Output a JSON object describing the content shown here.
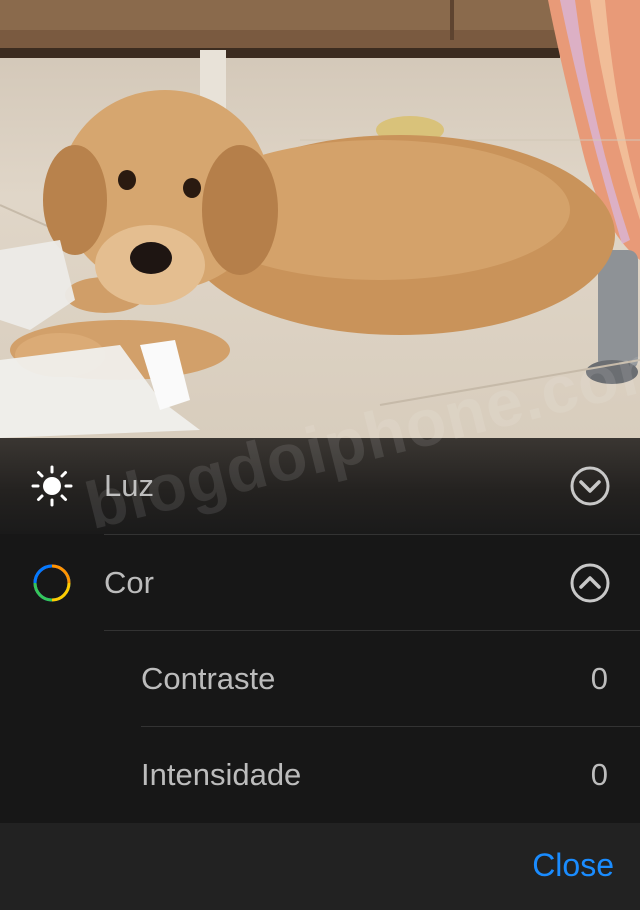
{
  "photo": {
    "subject": "golden retriever puppy lying on tiled floor"
  },
  "watermark": "blogdoiphone.com",
  "adjustments": {
    "light": {
      "label": "Luz",
      "icon": "sun-icon",
      "state_icon": "chevron-down-circle-icon"
    },
    "color": {
      "label": "Cor",
      "icon": "color-ring-icon",
      "state_icon": "chevron-up-circle-icon"
    },
    "contrast": {
      "label": "Contraste",
      "value": "0"
    },
    "intensity": {
      "label": "Intensidade",
      "value": "0"
    }
  },
  "footer": {
    "close_label": "Close"
  },
  "colors": {
    "accent": "#1a8cff",
    "panel_bg": "#171717",
    "text": "#bcbcbc"
  }
}
